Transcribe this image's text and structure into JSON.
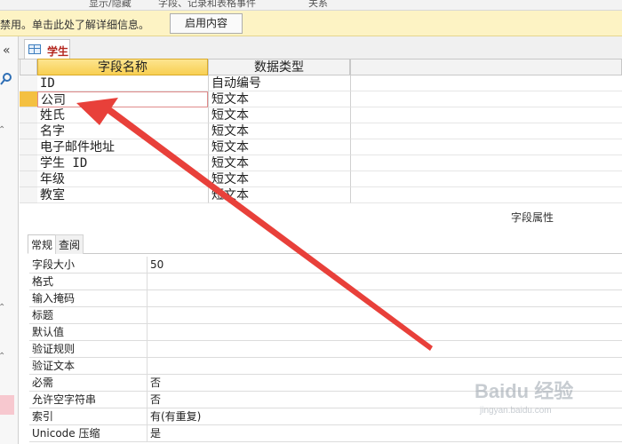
{
  "ribbon": {
    "items": [
      "显示/隐藏",
      "字段、记录和表格事件",
      "关系"
    ]
  },
  "message_bar": {
    "text": "禁用。单击此处了解详细信息。",
    "button_label": "启用内容"
  },
  "nav_pane": {
    "collapse_glyph": "«",
    "search_icon": "search-icon"
  },
  "object_tab": {
    "label": "学生",
    "icon": "table-icon"
  },
  "design_grid": {
    "columns": [
      "字段名称",
      "数据类型"
    ],
    "rows": [
      {
        "field": "ID",
        "type": "自动编号"
      },
      {
        "field": "公司",
        "type": "短文本"
      },
      {
        "field": "姓氏",
        "type": "短文本"
      },
      {
        "field": "名字",
        "type": "短文本"
      },
      {
        "field": "电子邮件地址",
        "type": "短文本"
      },
      {
        "field": "学生 ID",
        "type": "短文本"
      },
      {
        "field": "年级",
        "type": "短文本"
      },
      {
        "field": "教室",
        "type": "短文本"
      }
    ],
    "current_row": 1,
    "accent_color": "#f8cf52"
  },
  "properties": {
    "section_title": "字段属性",
    "tabs": [
      "常规",
      "查阅"
    ],
    "active_tab": "常规",
    "rows": [
      {
        "name": "字段大小",
        "value": "50"
      },
      {
        "name": "格式",
        "value": ""
      },
      {
        "name": "输入掩码",
        "value": ""
      },
      {
        "name": "标题",
        "value": ""
      },
      {
        "name": "默认值",
        "value": ""
      },
      {
        "name": "验证规则",
        "value": ""
      },
      {
        "name": "验证文本",
        "value": ""
      },
      {
        "name": "必需",
        "value": "否"
      },
      {
        "name": "允许空字符串",
        "value": "否"
      },
      {
        "name": "索引",
        "value": "有(有重复)"
      },
      {
        "name": "Unicode 压缩",
        "value": "是"
      }
    ]
  },
  "annotation": {
    "arrow_color": "#e8403a"
  },
  "watermark": {
    "text": "Baidu 经验",
    "subtext": "jingyan.baidu.com"
  }
}
